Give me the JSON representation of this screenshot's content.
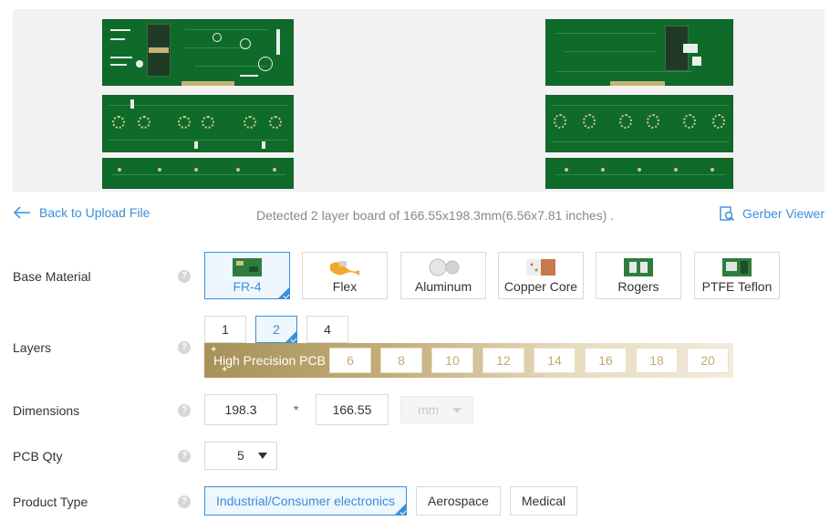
{
  "preview": {
    "board_color": "#0f6b2a",
    "pad_color": "#d8c38a"
  },
  "toolbar": {
    "back_label": "Back to Upload File",
    "detected_text": "Detected 2 layer board of 166.55x198.3mm(6.56x7.81 inches) .",
    "gerber_label": "Gerber Viewer"
  },
  "colors": {
    "accent": "#3b8fd8",
    "gold": "#c4ab72"
  },
  "form": {
    "base_material": {
      "label": "Base Material",
      "options": [
        "FR-4",
        "Flex",
        "Aluminum",
        "Copper Core",
        "Rogers",
        "PTFE Teflon"
      ],
      "selected": "FR-4"
    },
    "layers": {
      "label": "Layers",
      "options": [
        "1",
        "2",
        "4"
      ],
      "selected": "2",
      "high_precision_label": "High Precision PCB",
      "high_precision_options": [
        "6",
        "8",
        "10",
        "12",
        "14",
        "16",
        "18",
        "20"
      ]
    },
    "dimensions": {
      "label": "Dimensions",
      "length": "198.3",
      "separator": "*",
      "width": "166.55",
      "unit": "mm"
    },
    "pcb_qty": {
      "label": "PCB Qty",
      "value": "5"
    },
    "product_type": {
      "label": "Product Type",
      "options": [
        "Industrial/Consumer electronics",
        "Aerospace",
        "Medical"
      ],
      "selected": "Industrial/Consumer electronics"
    }
  }
}
